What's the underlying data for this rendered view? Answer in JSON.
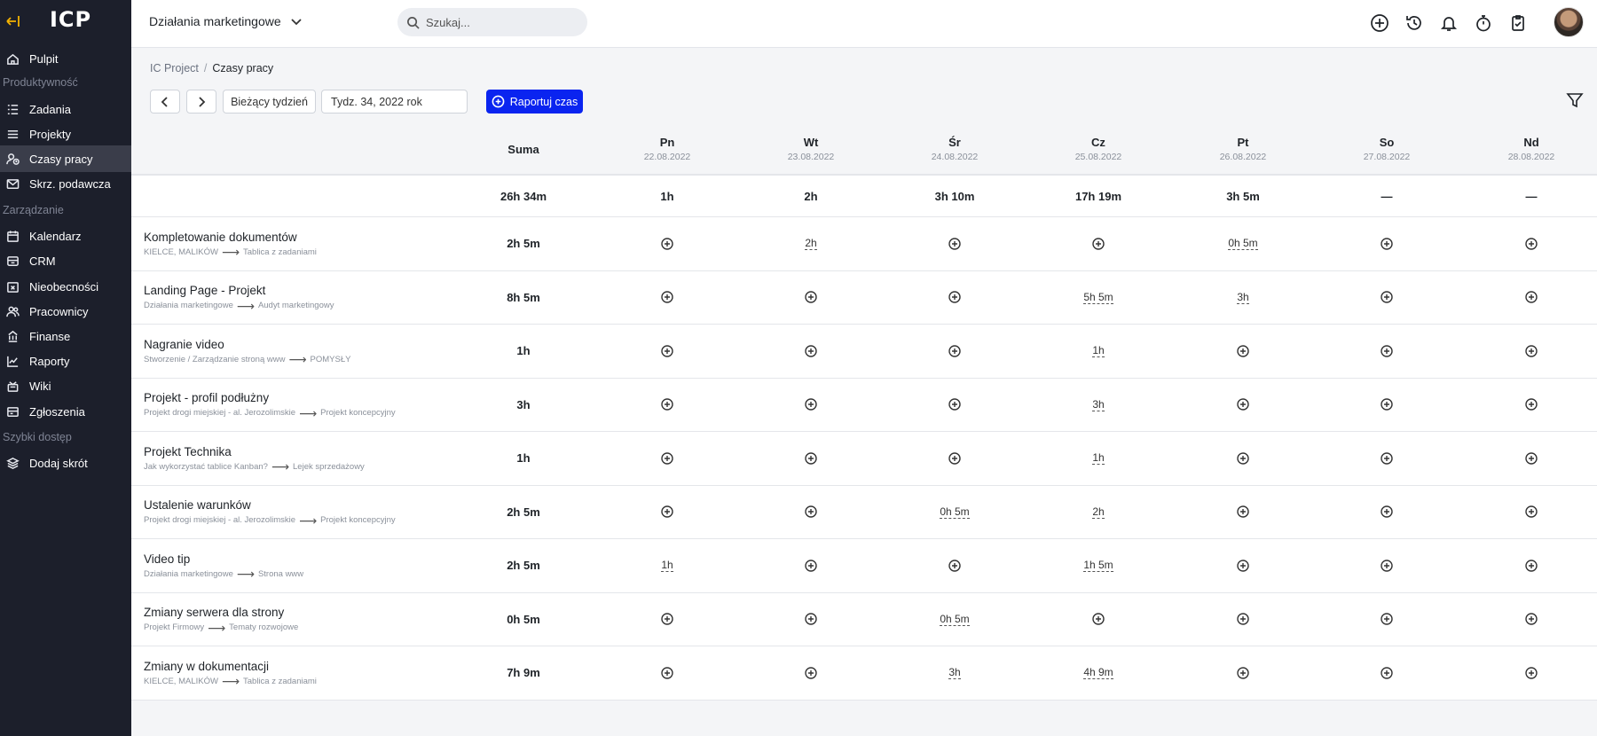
{
  "brand": {
    "logo": "ICP"
  },
  "sidebar": {
    "items": [
      {
        "label": "Pulpit",
        "icon": "home-icon"
      },
      {
        "section": "Produktywność"
      },
      {
        "label": "Zadania",
        "icon": "tasks-icon"
      },
      {
        "label": "Projekty",
        "icon": "projects-icon"
      },
      {
        "label": "Czasy pracy",
        "icon": "user-clock-icon",
        "active": true
      },
      {
        "label": "Skrz. podawcza",
        "icon": "mail-icon"
      },
      {
        "section": "Zarządzanie"
      },
      {
        "label": "Kalendarz",
        "icon": "calendar-icon"
      },
      {
        "label": "CRM",
        "icon": "crm-icon"
      },
      {
        "label": "Nieobecności",
        "icon": "absence-icon"
      },
      {
        "label": "Pracownicy",
        "icon": "employees-icon"
      },
      {
        "label": "Finanse",
        "icon": "finance-icon"
      },
      {
        "label": "Raporty",
        "icon": "reports-icon"
      },
      {
        "label": "Wiki",
        "icon": "wiki-icon"
      },
      {
        "label": "Zgłoszenia",
        "icon": "tickets-icon"
      },
      {
        "section": "Szybki dostęp"
      },
      {
        "label": "Dodaj skrót",
        "icon": "shortcut-icon"
      }
    ]
  },
  "topbar": {
    "workspace": "Działania marketingowe",
    "search_placeholder": "Szukaj..."
  },
  "breadcrumb": {
    "root": "IC Project",
    "separator": "/",
    "current": "Czasy pracy"
  },
  "toolbar": {
    "current_week_label": "Bieżący tydzień",
    "week_value": "Tydz. 34, 2022 rok",
    "report_label": "Raportuj czas"
  },
  "table": {
    "sum_header": "Suma",
    "days": [
      {
        "name": "Pn",
        "date": "22.08.2022"
      },
      {
        "name": "Wt",
        "date": "23.08.2022"
      },
      {
        "name": "Śr",
        "date": "24.08.2022"
      },
      {
        "name": "Cz",
        "date": "25.08.2022"
      },
      {
        "name": "Pt",
        "date": "26.08.2022"
      },
      {
        "name": "So",
        "date": "27.08.2022"
      },
      {
        "name": "Nd",
        "date": "28.08.2022"
      }
    ],
    "totals": {
      "sum": "26h 34m",
      "days": [
        "1h",
        "2h",
        "3h 10m",
        "17h 19m",
        "3h 5m",
        "—",
        "—"
      ]
    },
    "rows": [
      {
        "name": "Kompletowanie dokumentów",
        "from": "KIELCE, MALIKÓW",
        "to": "Tablica z zadaniami",
        "sum": "2h 5m",
        "days": [
          "",
          "2h",
          "",
          "",
          "0h 5m",
          "",
          ""
        ]
      },
      {
        "name": "Landing Page - Projekt",
        "from": "Działania marketingowe",
        "to": "Audyt marketingowy",
        "sum": "8h 5m",
        "days": [
          "",
          "",
          "",
          "5h 5m",
          "3h",
          "",
          ""
        ]
      },
      {
        "name": "Nagranie video",
        "from": "Stworzenie / Zarządzanie stroną www",
        "to": "POMYSŁY",
        "sum": "1h",
        "days": [
          "",
          "",
          "",
          "1h",
          "",
          "",
          ""
        ]
      },
      {
        "name": "Projekt - profil podłużny",
        "from": "Projekt drogi miejskiej - al. Jerozolimskie",
        "to": "Projekt koncepcyjny",
        "sum": "3h",
        "days": [
          "",
          "",
          "",
          "3h",
          "",
          "",
          ""
        ]
      },
      {
        "name": "Projekt Technika",
        "from": "Jak wykorzystać tablice Kanban?",
        "to": "Lejek sprzedażowy",
        "sum": "1h",
        "days": [
          "",
          "",
          "",
          "1h",
          "",
          "",
          ""
        ]
      },
      {
        "name": "Ustalenie warunków",
        "from": "Projekt drogi miejskiej - al. Jerozolimskie",
        "to": "Projekt koncepcyjny",
        "sum": "2h 5m",
        "days": [
          "",
          "",
          "0h 5m",
          "2h",
          "",
          "",
          ""
        ]
      },
      {
        "name": "Video tip",
        "from": "Działania marketingowe",
        "to": "Strona www",
        "sum": "2h 5m",
        "days": [
          "1h",
          "",
          "",
          "1h 5m",
          "",
          "",
          ""
        ]
      },
      {
        "name": "Zmiany serwera dla strony",
        "from": "Projekt Firmowy",
        "to": "Tematy rozwojowe",
        "sum": "0h 5m",
        "days": [
          "",
          "",
          "0h 5m",
          "",
          "",
          "",
          ""
        ]
      },
      {
        "name": "Zmiany w dokumentacji",
        "from": "KIELCE, MALIKÓW",
        "to": "Tablica z zadaniami",
        "sum": "7h 9m",
        "days": [
          "",
          "",
          "3h",
          "4h 9m",
          "",
          "",
          ""
        ]
      }
    ]
  },
  "colors": {
    "sidebar_bg": "#1c1f2b",
    "sidebar_active": "#3a3d4a",
    "primary": "#0a24f0",
    "accent_icon": "#f5b301"
  }
}
